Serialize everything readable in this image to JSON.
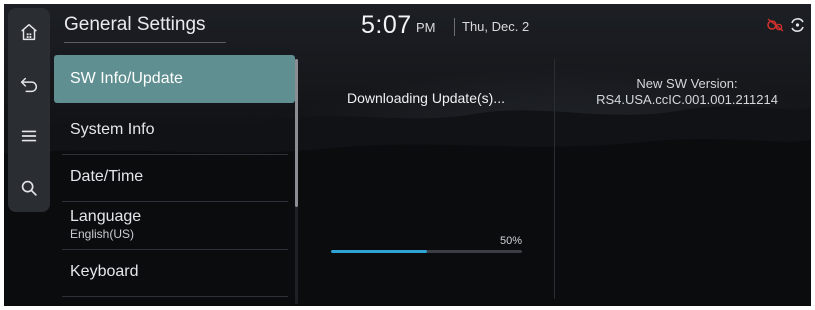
{
  "header": {
    "title": "General Settings",
    "time": "5:07",
    "ampm": "PM",
    "date": "Thu, Dec. 2"
  },
  "rail": {
    "icons": [
      "home-icon",
      "back-icon",
      "menu-icon",
      "search-icon"
    ]
  },
  "status_icons": [
    "connected-car-off-icon",
    "sync-icon"
  ],
  "menu": {
    "items": [
      {
        "label": "SW Info/Update",
        "active": true
      },
      {
        "label": "System Info"
      },
      {
        "label": "Date/Time"
      },
      {
        "label": "Language",
        "sublabel": "English(US)"
      },
      {
        "label": "Keyboard"
      }
    ]
  },
  "update": {
    "status": "Downloading Update(s)...",
    "version_label": "New SW Version:",
    "version_value": "RS4.USA.ccIC.001.001.211214",
    "progress_label": "50%",
    "progress": 0.5
  },
  "colors": {
    "accent": "#2ea3d6",
    "active_item": "#5f8f90",
    "status_red": "#d0312d"
  }
}
